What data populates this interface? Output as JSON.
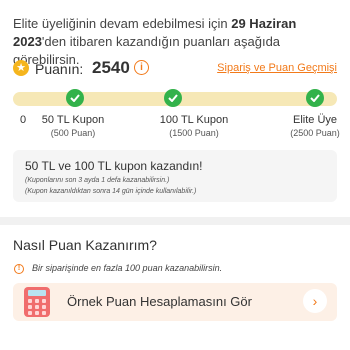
{
  "intro": {
    "prefix": "Elite üyeliğinin devam edebilmesi için ",
    "date": "29 Haziran 2023",
    "suffix": "'den itibaren kazandığın puanları aşağıda görebilirsin."
  },
  "points": {
    "label": "Puanın:",
    "value": "2540",
    "history_link": "Sipariş ve Puan Geçmişi"
  },
  "progress": {
    "fraction": 1.0,
    "start_label": "0",
    "tiers": [
      {
        "name": "50 TL Kupon",
        "points": "(500 Puan)"
      },
      {
        "name": "100 TL Kupon",
        "points": "(1500 Puan)"
      },
      {
        "name": "Elite Üye",
        "points": "(2500 Puan)"
      }
    ]
  },
  "earned": {
    "title": "50 TL ve 100 TL kupon kazandın!",
    "note1": "(Kuponlarını son 3 ayda 1 defa kazanabilirsin.)",
    "note2": "(Kupon kazanıldıktan sonra 14 gün içinde kullanılabilir.)"
  },
  "how": {
    "title": "Nasıl Puan Kazanırım?",
    "warning": "Bir siparişinde en fazla 100 puan kazanabilirsin.",
    "calc_label": "Örnek Puan Hesaplamasını Gör"
  },
  "colors": {
    "accent": "#f27a1a",
    "success": "#33b24b",
    "track": "#f6e8b6",
    "star": "#f5b51d"
  }
}
